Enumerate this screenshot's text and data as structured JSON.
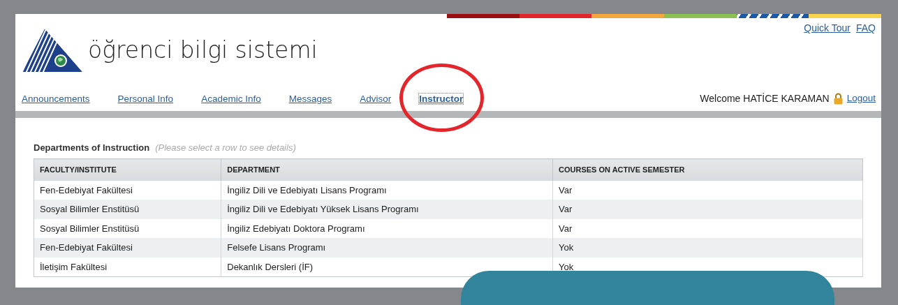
{
  "header": {
    "logo_text": "öğrenci bilgi sistemi",
    "top_links": [
      "Quick Tour",
      "FAQ"
    ]
  },
  "nav": [
    {
      "label": "Announcements",
      "selected": false,
      "circled": false
    },
    {
      "label": "Personal Info",
      "selected": false,
      "circled": false
    },
    {
      "label": "Academic Info",
      "selected": false,
      "circled": false
    },
    {
      "label": "Messages",
      "selected": false,
      "circled": false
    },
    {
      "label": "Advisor",
      "selected": false,
      "circled": false
    },
    {
      "label": "Instructor",
      "selected": true,
      "circled": true
    }
  ],
  "user": {
    "welcome": "Welcome HATİCE KARAMAN",
    "logout": "Logout"
  },
  "section": {
    "title": "Departments of Instruction",
    "hint": "(Please select a row to see details)"
  },
  "table": {
    "columns": [
      "FACULTY/INSTITUTE",
      "DEPARTMENT",
      "COURSES ON ACTIVE SEMESTER"
    ],
    "rows": [
      [
        "Fen-Edebiyat Fakültesi",
        "İngiliz Dili ve Edebiyatı Lisans Programı",
        "Var"
      ],
      [
        "Sosyal Bilimler Enstitüsü",
        "İngiliz Dili ve Edebiyatı Yüksek Lisans Programı",
        "Var"
      ],
      [
        "Sosyal Bilimler Enstitüsü",
        "İngiliz Edebiyatı Doktora Programı",
        "Var"
      ],
      [
        "Fen-Edebiyat Fakültesi",
        "Felsefe Lisans Programı",
        "Yok"
      ],
      [
        "İletişim Fakültesi",
        "Dekanlık Dersleri (İF)",
        "Yok"
      ]
    ]
  },
  "overlay_panel": {
    "rounded": true
  }
}
